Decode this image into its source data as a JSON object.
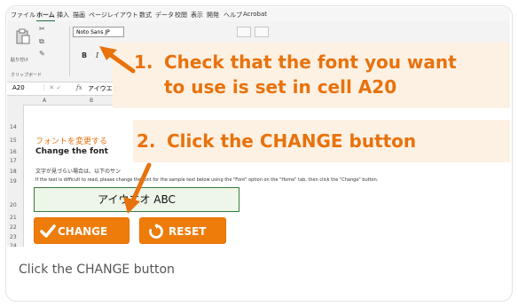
{
  "menu": [
    "ファイル",
    "ホーム",
    "挿入",
    "描画",
    "ページレイアウト",
    "数式",
    "データ",
    "校閲",
    "表示",
    "開発",
    "ヘルプ",
    "Acrobat"
  ],
  "ribbon": {
    "font_name": "Noto Sans JP",
    "paste_label": "貼り付け",
    "clipboard_label": "クリップボード",
    "bold": "B",
    "italic": "I"
  },
  "formula_bar": {
    "cell_ref": "A20",
    "fx": "fx",
    "value": "アイウエオ"
  },
  "columns": [
    "A",
    "B"
  ],
  "rows": [
    "14",
    "15",
    "16",
    "17",
    "18",
    "19",
    "20",
    "21",
    "22",
    "23",
    "24"
  ],
  "sheet": {
    "title": "フォントを変更する",
    "subtitle": "Change the font",
    "desc_jp": "文字が見づらい場合は、以下のサン",
    "desc_en": "If the text is difficult to read, please change the font for the sample text below using the \"Font\" option on the \"Home\" tab, then click the \"Change\" button.",
    "sample_text": "アイウエオ ABC"
  },
  "buttons": {
    "change": "CHANGE",
    "reset": "RESET"
  },
  "callouts": {
    "step1_num": "1.",
    "step1_line1": "Check that the font you want",
    "step1_line2": "to use is set in cell A20",
    "step2_num": "2.",
    "step2_line1": "Click the CHANGE button"
  },
  "caption": "Click the CHANGE button",
  "colors": {
    "accent": "#ee7c0a",
    "callout_bg": "#fdf1e2",
    "callout_text": "#e8720c"
  }
}
